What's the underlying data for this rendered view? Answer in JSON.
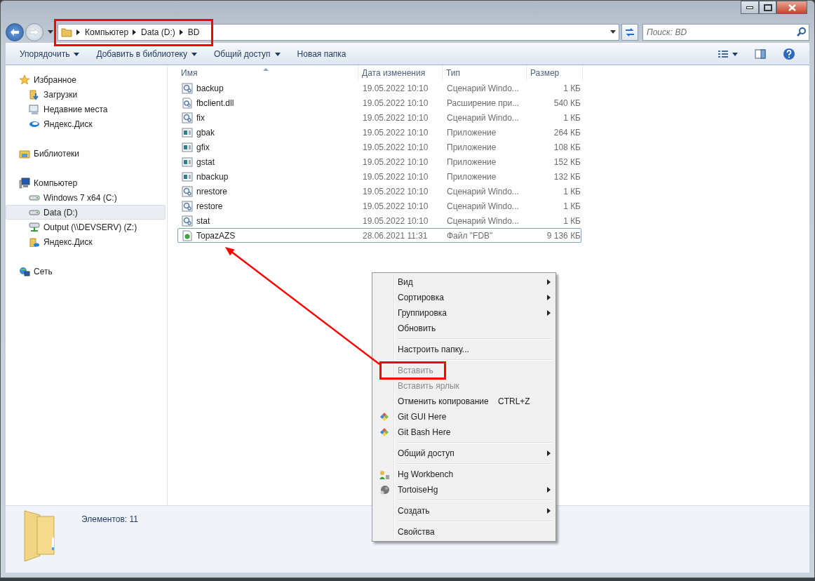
{
  "address": {
    "segments": [
      "Компьютер",
      "Data (D:)",
      "BD"
    ],
    "highlighted": true
  },
  "search": {
    "placeholder": "Поиск: BD"
  },
  "toolbar": [
    {
      "label": "Упорядочить",
      "dropdown": true
    },
    {
      "label": "Добавить в библиотеку",
      "dropdown": true
    },
    {
      "label": "Общий доступ",
      "dropdown": true
    },
    {
      "label": "Новая папка",
      "dropdown": false
    }
  ],
  "nav": [
    {
      "label": "Избранное",
      "children": [
        {
          "label": "Загрузки",
          "selected": false
        },
        {
          "label": "Недавние места",
          "selected": false
        },
        {
          "label": "Яндекс.Диск",
          "selected": false
        }
      ]
    },
    {
      "label": "Библиотеки"
    },
    {
      "label": "Компьютер",
      "children": [
        {
          "label": "Windows 7 x64 (C:)",
          "selected": false
        },
        {
          "label": "Data (D:)",
          "selected": true
        },
        {
          "label": "Output (\\\\DEVSERV) (Z:)",
          "selected": false
        },
        {
          "label": "Яндекс.Диск",
          "selected": false
        }
      ]
    },
    {
      "label": "Сеть"
    }
  ],
  "table": {
    "columns": [
      "Имя",
      "Дата изменения",
      "Тип",
      "Размер"
    ],
    "rows": [
      {
        "kind": "script",
        "name": "backup",
        "date": "19.05.2022 10:10",
        "type": "Сценарий Windo...",
        "size": "1 КБ",
        "focused": false
      },
      {
        "kind": "dll",
        "name": "fbclient.dll",
        "date": "19.05.2022 10:10",
        "type": "Расширение при...",
        "size": "540 КБ",
        "focused": false
      },
      {
        "kind": "script",
        "name": "fix",
        "date": "19.05.2022 10:10",
        "type": "Сценарий Windo...",
        "size": "1 КБ",
        "focused": false
      },
      {
        "kind": "app",
        "name": "gbak",
        "date": "19.05.2022 10:10",
        "type": "Приложение",
        "size": "264 КБ",
        "focused": false
      },
      {
        "kind": "app",
        "name": "gfix",
        "date": "19.05.2022 10:10",
        "type": "Приложение",
        "size": "108 КБ",
        "focused": false
      },
      {
        "kind": "app",
        "name": "gstat",
        "date": "19.05.2022 10:10",
        "type": "Приложение",
        "size": "152 КБ",
        "focused": false
      },
      {
        "kind": "app",
        "name": "nbackup",
        "date": "19.05.2022 10:10",
        "type": "Приложение",
        "size": "132 КБ",
        "focused": false
      },
      {
        "kind": "script",
        "name": "nrestore",
        "date": "19.05.2022 10:10",
        "type": "Сценарий Windo...",
        "size": "1 КБ",
        "focused": false
      },
      {
        "kind": "script",
        "name": "restore",
        "date": "19.05.2022 10:10",
        "type": "Сценарий Windo...",
        "size": "1 КБ",
        "focused": false
      },
      {
        "kind": "script",
        "name": "stat",
        "date": "19.05.2022 10:10",
        "type": "Сценарий Windo...",
        "size": "1 КБ",
        "focused": false
      },
      {
        "kind": "db",
        "name": "TopazAZS",
        "date": "28.06.2021 11:31",
        "type": "Файл \"FDB\"",
        "size": "9 136 КБ",
        "focused": true
      }
    ]
  },
  "details": {
    "text": "Элементов: 11"
  },
  "context_menu": [
    {
      "kind": "item",
      "label": "Вид",
      "submenu": true,
      "disabled": false
    },
    {
      "kind": "item",
      "label": "Сортировка",
      "submenu": true,
      "disabled": false
    },
    {
      "kind": "item",
      "label": "Группировка",
      "submenu": true,
      "disabled": false
    },
    {
      "kind": "item",
      "label": "Обновить",
      "submenu": false,
      "disabled": false
    },
    {
      "kind": "separator"
    },
    {
      "kind": "item",
      "label": "Настроить папку...",
      "submenu": false,
      "disabled": false
    },
    {
      "kind": "separator"
    },
    {
      "kind": "item",
      "label": "Вставить",
      "submenu": false,
      "disabled": true,
      "highlighted": true
    },
    {
      "kind": "item",
      "label": "Вставить ярлык",
      "submenu": false,
      "disabled": true
    },
    {
      "kind": "item",
      "label": "Отменить копирование",
      "shortcut": "CTRL+Z",
      "submenu": false,
      "disabled": false
    },
    {
      "kind": "icon_item",
      "label": "Git GUI Here",
      "submenu": false,
      "disabled": false
    },
    {
      "kind": "icon_item",
      "label": "Git Bash Here",
      "submenu": false,
      "disabled": false
    },
    {
      "kind": "separator"
    },
    {
      "kind": "item",
      "label": "Общий доступ",
      "submenu": true,
      "disabled": false
    },
    {
      "kind": "separator"
    },
    {
      "kind": "icon_item",
      "label": "Hg Workbench",
      "submenu": false,
      "disabled": false
    },
    {
      "kind": "icon_item",
      "label": "TortoiseHg",
      "submenu": true,
      "disabled": false
    },
    {
      "kind": "separator"
    },
    {
      "kind": "item",
      "label": "Создать",
      "submenu": true,
      "disabled": false
    },
    {
      "kind": "separator"
    },
    {
      "kind": "item",
      "label": "Свойства",
      "submenu": false,
      "disabled": false
    }
  ]
}
